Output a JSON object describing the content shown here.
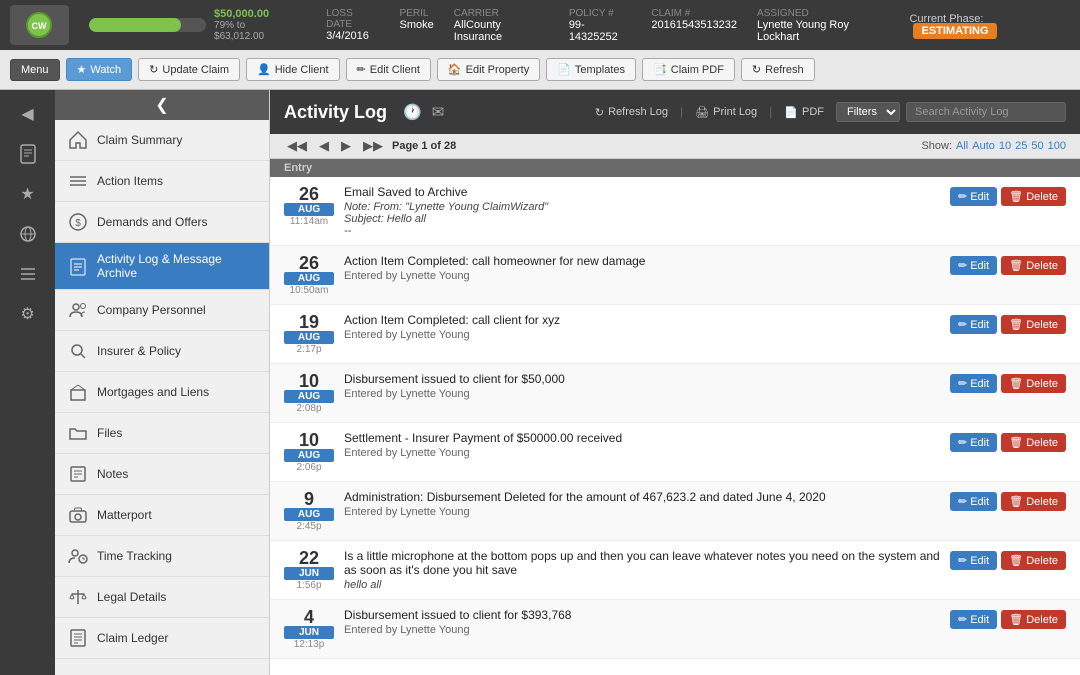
{
  "topbar": {
    "progress": {
      "percent": 79,
      "amount": "$50,000.00",
      "sub": "79% to $63,012.00"
    },
    "fields": [
      {
        "label": "LOSS DATE",
        "value": "3/4/2016"
      },
      {
        "label": "PERIL",
        "value": "Smoke"
      },
      {
        "label": "CARRIER",
        "value": "AllCounty Insurance"
      },
      {
        "label": "POLICY #",
        "value": "99-14325252"
      },
      {
        "label": "CLAIM #",
        "value": "20161543513232"
      },
      {
        "label": "ASSIGNED",
        "value": "Lynette Young  Roy Lockhart"
      }
    ],
    "phase_label": "Current Phase:",
    "phase_value": "ESTIMATING"
  },
  "toolbar": {
    "menu_label": "Menu",
    "watch_label": "Watch",
    "update_claim": "Update Claim",
    "hide_client": "Hide Client",
    "edit_client": "Edit Client",
    "edit_property": "Edit Property",
    "templates": "Templates",
    "claim_pdf": "Claim PDF",
    "refresh": "Refresh"
  },
  "sidebar": {
    "toggle_icon": "❮",
    "items": [
      {
        "id": "claim-summary",
        "icon": "🏠",
        "label": "Claim Summary"
      },
      {
        "id": "action-items",
        "icon": "✔",
        "label": "Action Items"
      },
      {
        "id": "demands-offers",
        "icon": "💲",
        "label": "Demands and Offers"
      },
      {
        "id": "activity-log",
        "icon": "📋",
        "label": "Activity Log & Message Archive",
        "active": true
      },
      {
        "id": "company-personnel",
        "icon": "👥",
        "label": "Company Personnel"
      },
      {
        "id": "insurer-policy",
        "icon": "🔍",
        "label": "Insurer & Policy"
      },
      {
        "id": "mortgages-liens",
        "icon": "🏛",
        "label": "Mortgages and Liens"
      },
      {
        "id": "files",
        "icon": "📁",
        "label": "Files"
      },
      {
        "id": "notes",
        "icon": "📝",
        "label": "Notes"
      },
      {
        "id": "matterport",
        "icon": "📷",
        "label": "Matterport"
      },
      {
        "id": "time-tracking",
        "icon": "👤",
        "label": "Time Tracking"
      },
      {
        "id": "legal-details",
        "icon": "⚖",
        "label": "Legal Details"
      },
      {
        "id": "claim-ledger",
        "icon": "📄",
        "label": "Claim Ledger"
      }
    ]
  },
  "icon_rail": {
    "items": [
      {
        "id": "nav-back",
        "icon": "◀",
        "label": "back"
      },
      {
        "id": "nav-doc",
        "icon": "📄",
        "label": "document"
      },
      {
        "id": "nav-star",
        "icon": "★",
        "label": "favorite"
      },
      {
        "id": "nav-globe",
        "icon": "🌐",
        "label": "globe"
      },
      {
        "id": "nav-layers",
        "icon": "☰",
        "label": "layers"
      },
      {
        "id": "nav-gear",
        "icon": "⚙",
        "label": "settings"
      }
    ]
  },
  "activity_log": {
    "title": "Activity Log",
    "clock_icon": "🕐",
    "mail_icon": "✉",
    "refresh_log": "Refresh Log",
    "print_log": "Print Log",
    "pdf": "PDF",
    "filters_label": "Filters",
    "search_placeholder": "Search Activity Log",
    "pagination": {
      "current_page": 1,
      "total_pages": 28,
      "label": "Page 1 of 28"
    },
    "show": {
      "label": "Show:",
      "options": [
        "All",
        "Auto",
        "10",
        "25",
        "50",
        "100"
      ]
    },
    "entry_header": "Entry",
    "entries": [
      {
        "day": "26",
        "month": "AUG",
        "time": "11:14am",
        "text": "Email Saved to Archive",
        "note": "Note: From: \"Lynette Young  ClaimWizard\"\nSubject: Hello all\n--",
        "subtext": ""
      },
      {
        "day": "26",
        "month": "AUG",
        "time": "10:50am",
        "text": "Action Item Completed: call homeowner for new damage",
        "note": "",
        "subtext": "Entered by Lynette Young"
      },
      {
        "day": "19",
        "month": "AUG",
        "time": "2:17p",
        "text": "Action Item Completed: call client for xyz",
        "note": "",
        "subtext": "Entered by Lynette Young"
      },
      {
        "day": "10",
        "month": "AUG",
        "time": "2:08p",
        "text": "Disbursement issued to client for $50,000",
        "note": "",
        "subtext": "Entered by Lynette Young"
      },
      {
        "day": "10",
        "month": "AUG",
        "time": "2:06p",
        "text": "Settlement - Insurer Payment of $50000.00 received",
        "note": "",
        "subtext": "Entered by Lynette Young"
      },
      {
        "day": "9",
        "month": "AUG",
        "time": "2:45p",
        "text": "Administration: Disbursement Deleted for the amount of 467,623.2 and dated June 4, 2020",
        "note": "",
        "subtext": "Entered by Lynette Young"
      },
      {
        "day": "22",
        "month": "JUN",
        "time": "1:56p",
        "text": "Is a little microphone at the bottom pops up and then you can leave whatever notes you need on the system and as soon as it's done you hit save",
        "note": "hello all",
        "subtext": ""
      },
      {
        "day": "4",
        "month": "JUN",
        "time": "12:13p",
        "text": "Disbursement issued to client for $393,768",
        "note": "",
        "subtext": "Entered by Lynette Young"
      }
    ]
  }
}
